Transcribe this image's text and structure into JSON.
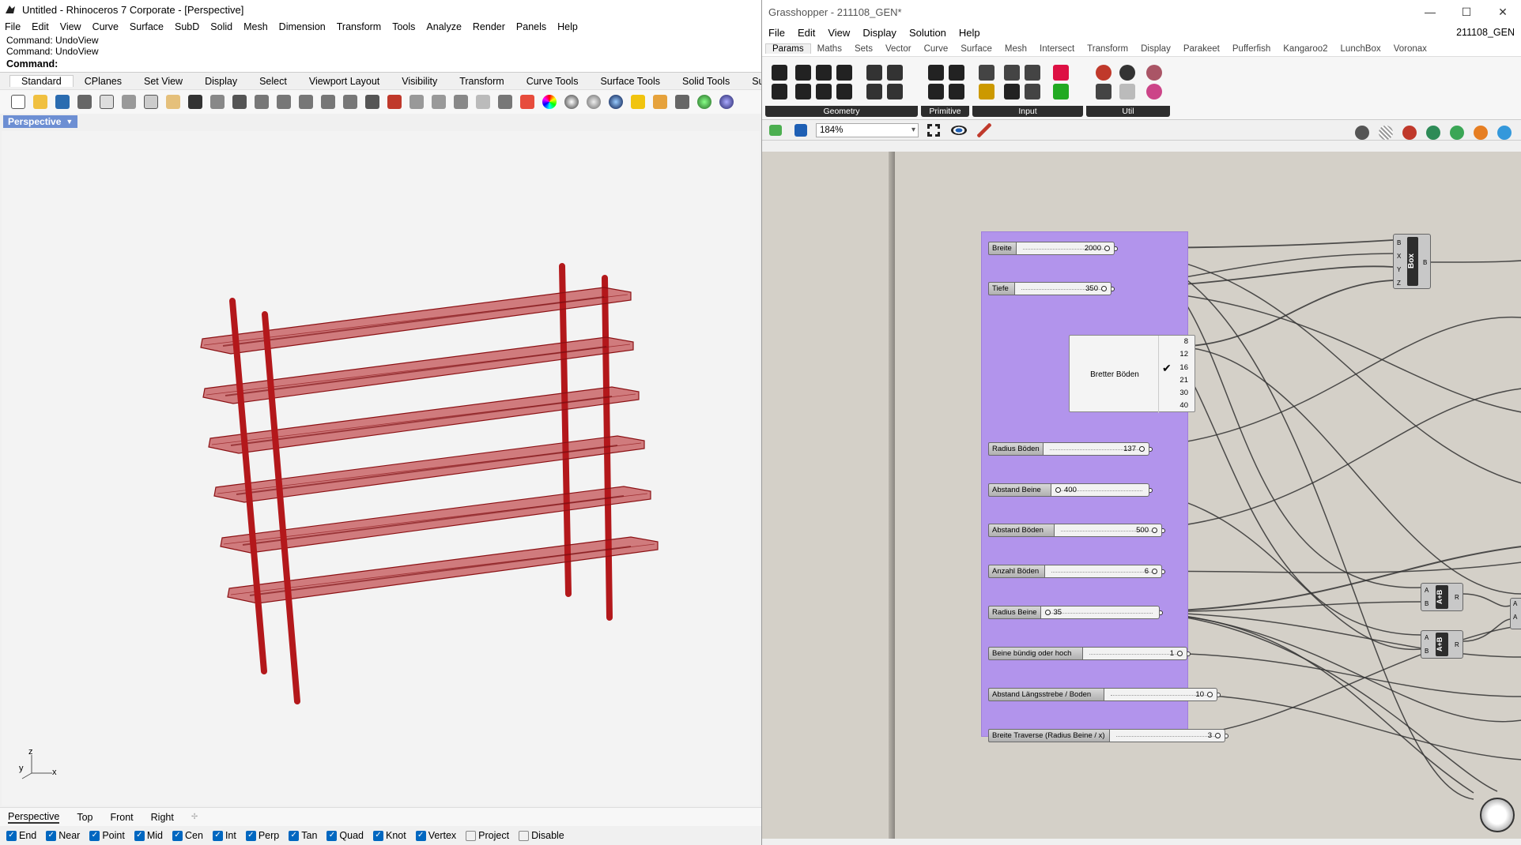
{
  "rhino": {
    "window_title": "Untitled - Rhinoceros 7 Corporate - [Perspective]",
    "menu": [
      "File",
      "Edit",
      "View",
      "Curve",
      "Surface",
      "SubD",
      "Solid",
      "Mesh",
      "Dimension",
      "Transform",
      "Tools",
      "Analyze",
      "Render",
      "Panels",
      "Help"
    ],
    "command_history": [
      "Command: UndoView",
      "Command: UndoView"
    ],
    "command_prompt": "Command:",
    "toolbar_tabs": [
      "Standard",
      "CPlanes",
      "Set View",
      "Display",
      "Select",
      "Viewport Layout",
      "Visibility",
      "Transform",
      "Curve Tools",
      "Surface Tools",
      "Solid Tools",
      "SubD Tools"
    ],
    "active_toolbar_tab": "Standard",
    "viewport_name": "Perspective",
    "axis_labels": {
      "z": "z",
      "y": "y",
      "x": "x"
    },
    "viewport_tabs": [
      "Perspective",
      "Top",
      "Front",
      "Right"
    ],
    "osnaps": [
      {
        "label": "End",
        "checked": true
      },
      {
        "label": "Near",
        "checked": true
      },
      {
        "label": "Point",
        "checked": true
      },
      {
        "label": "Mid",
        "checked": true
      },
      {
        "label": "Cen",
        "checked": true
      },
      {
        "label": "Int",
        "checked": true
      },
      {
        "label": "Perp",
        "checked": true
      },
      {
        "label": "Tan",
        "checked": true
      },
      {
        "label": "Quad",
        "checked": true
      },
      {
        "label": "Knot",
        "checked": true
      },
      {
        "label": "Vertex",
        "checked": true
      },
      {
        "label": "Project",
        "checked": false
      },
      {
        "label": "Disable",
        "checked": false
      }
    ],
    "model_color": "#b3181b"
  },
  "gh": {
    "window_title": "Grasshopper - 211108_GEN*",
    "window_controls": [
      "—",
      "☐",
      "✕"
    ],
    "menu": [
      "File",
      "Edit",
      "View",
      "Display",
      "Solution",
      "Help"
    ],
    "document_name": "211108_GEN",
    "tabs": [
      "Params",
      "Maths",
      "Sets",
      "Vector",
      "Curve",
      "Surface",
      "Mesh",
      "Intersect",
      "Transform",
      "Display",
      "Parakeet",
      "Pufferfish",
      "Kangaroo2",
      "LunchBox",
      "Voronax"
    ],
    "active_tab": "Params",
    "panels": [
      "Geometry",
      "Primitive",
      "Input",
      "Util"
    ],
    "zoom": "184%",
    "group_color": "#b294ec",
    "sliders": [
      {
        "label": "Breite",
        "value": "2000"
      },
      {
        "label": "Tiefe",
        "value": "350"
      },
      {
        "label": "Radius Böden",
        "value": "137"
      },
      {
        "label": "Abstand Beine",
        "value": "400"
      },
      {
        "label": "Abstand Böden",
        "value": "500"
      },
      {
        "label": "Anzahl Böden",
        "value": "6"
      },
      {
        "label": "Radius Beine",
        "value": "35"
      },
      {
        "label": "Beine bündig oder hoch",
        "value": "1"
      },
      {
        "label": "Abstand Längsstrebe / Boden",
        "value": "10"
      },
      {
        "label": "Breite Traverse (Radius Beine / x)",
        "value": "3"
      }
    ],
    "value_list": {
      "name": "Bretter Böden",
      "items": [
        "8",
        "12",
        "16",
        "21",
        "30",
        "40"
      ],
      "selected": "16"
    },
    "box_component": {
      "name": "Box",
      "inputs": [
        "B",
        "X",
        "Y",
        "Z"
      ],
      "output": "B"
    },
    "add_component_1": {
      "name": "A+B",
      "inputs": [
        "A",
        "B"
      ],
      "output": "R"
    },
    "add_component_2": {
      "name": "A+B",
      "inputs": [
        "A",
        "B"
      ],
      "output": "R"
    },
    "partial_inputs": [
      "A",
      "A"
    ]
  }
}
